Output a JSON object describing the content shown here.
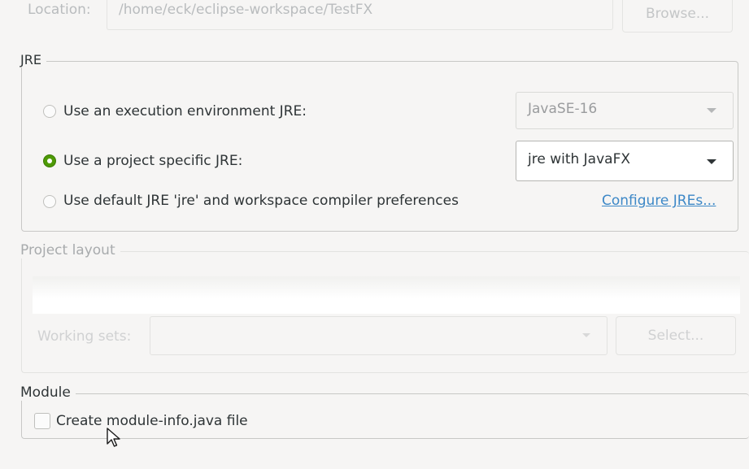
{
  "location": {
    "label": "Location:",
    "path": "/home/eck/eclipse-workspace/TestFX",
    "browse_label": "Browse..."
  },
  "jre": {
    "title": "JRE",
    "options": [
      {
        "label": "Use an execution environment JRE:",
        "selected": false
      },
      {
        "label": "Use a project specific JRE:",
        "selected": true
      },
      {
        "label": "Use default JRE 'jre' and workspace compiler preferences",
        "selected": false
      }
    ],
    "env_combo_value": "JavaSE-16",
    "project_combo_value": "jre with JavaFX",
    "configure_link": "Configure JREs..."
  },
  "project_layout": {
    "title": "Project layout",
    "working_sets_label": "Working sets:",
    "select_label": "Select..."
  },
  "module": {
    "title": "Module",
    "checkbox_label": "Create module-info.java file",
    "checked": false
  },
  "colors": {
    "accent_radio": "#4e9a06",
    "link": "#3d88c7",
    "background": "#f6f5f4"
  }
}
